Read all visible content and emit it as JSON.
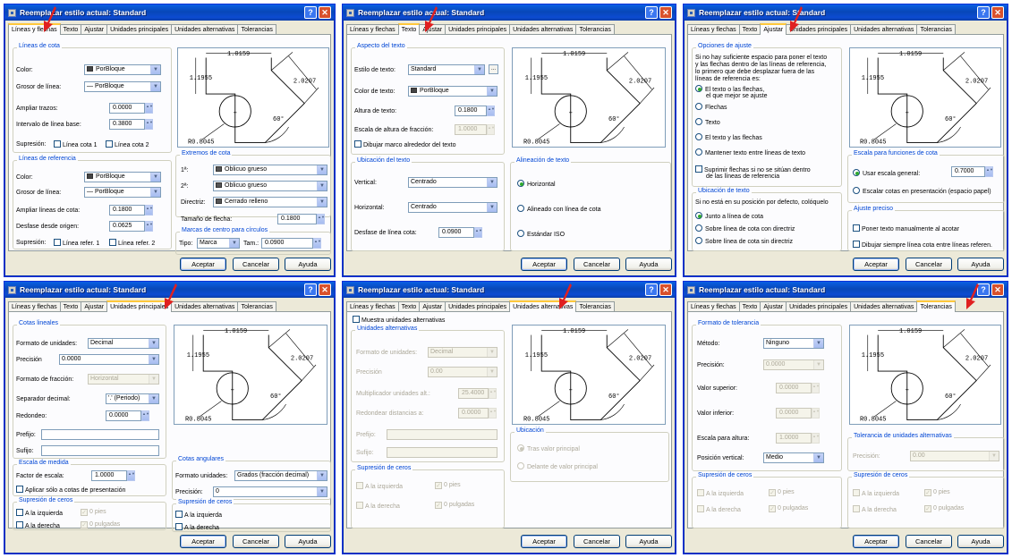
{
  "dialog_title": "Reemplazar estilo actual: Standard",
  "title_buttons": {
    "help": "?",
    "close": "✕"
  },
  "tabs": [
    "Líneas y flechas",
    "Texto",
    "Ajustar",
    "Unidades principales",
    "Unidades alternativas",
    "Tolerancias"
  ],
  "buttons": {
    "ok": "Aceptar",
    "cancel": "Cancelar",
    "help": "Ayuda"
  },
  "preview": {
    "top_dim": "1.0159",
    "left_dim": "1.1955",
    "right_dim": "2.0207",
    "radius": "R0.8045",
    "angle": "60°",
    "center": "+"
  },
  "combo_arrow": "▼",
  "spin_arrows": "▲▼",
  "ellipsis": "...",
  "accent_colors": {
    "titlebar": "#0a5fe4",
    "group_label": "#0046d5",
    "arrow_marker": "#e02020"
  },
  "d1": {
    "g_cota": "Líneas de cota",
    "color_lbl": "Color:",
    "color_val": "PorBloque",
    "grosor_lbl": "Grosor de línea:",
    "grosor_val": "— PorBloque",
    "ampliar_lbl": "Ampliar trazos:",
    "ampliar_val": "0.0000",
    "intervalo_lbl": "Intervalo de línea base:",
    "intervalo_val": "0.3800",
    "supresion_lbl": "Supresión:",
    "sup1": "Línea cota 1",
    "sup2": "Línea cota 2",
    "g_ref": "Líneas de referencia",
    "rcolor_lbl": "Color:",
    "rcolor_val": "PorBloque",
    "rgrosor_lbl": "Grosor de línea:",
    "rgrosor_val": "— PorBloque",
    "rampliar_lbl": "Ampliar líneas de cota:",
    "rampliar_val": "0.1800",
    "desfase_lbl": "Desfase desde origen:",
    "desfase_val": "0.0625",
    "rsupresion_lbl": "Supresión:",
    "rsup1": "Línea refer. 1",
    "rsup2": "Línea refer. 2",
    "g_ext": "Extremos de cota",
    "e1_lbl": "1ª:",
    "e1_val": "Oblicuo grueso",
    "e2_lbl": "2ª:",
    "e2_val": "Oblicuo grueso",
    "dir_lbl": "Directriz:",
    "dir_val": "Cerrado relleno",
    "tam_lbl": "Tamaño de flecha:",
    "tam_val": "0.1800",
    "g_centro": "Marcas de centro para círculos",
    "tipo_lbl": "Tipo:",
    "tipo_val": "Marca",
    "tamc_lbl": "Tam.:",
    "tamc_val": "0.0900"
  },
  "d2": {
    "g_aspecto": "Aspecto del texto",
    "estilo_lbl": "Estilo de texto:",
    "estilo_val": "Standard",
    "color_lbl": "Color de texto:",
    "color_val": "PorBloque",
    "altura_lbl": "Altura de texto:",
    "altura_val": "0.1800",
    "escala_lbl": "Escala de altura de fracción:",
    "escala_val": "1.0000",
    "marco": "Dibujar marco alrededor del texto",
    "g_ubic": "Ubicación del texto",
    "vert_lbl": "Vertical:",
    "vert_val": "Centrado",
    "horiz_lbl": "Horizontal:",
    "horiz_val": "Centrado",
    "desf_lbl": "Desfase de línea cota:",
    "desf_val": "0.0900",
    "g_alin": "Alineación de texto",
    "r1": "Horizontal",
    "r2": "Alineado con línea de cota",
    "r3": "Estándar ISO"
  },
  "d3": {
    "g_opc": "Opciones de ajuste",
    "intro": [
      "Si no hay suficiente espacio para poner el texto",
      "y las flechas dentro de las líneas de referencia,",
      "lo primero que debe desplazar fuera de las",
      "líneas de referencia es:"
    ],
    "r1a": "El texto o las flechas,",
    "r1b": "el que mejor se ajuste",
    "r2": "Flechas",
    "r3": "Texto",
    "r4": "El texto y las flechas",
    "r5": "Mantener texto entre líneas de texto",
    "sup_a": "Suprimir flechas si no se sitúan dentro",
    "sup_b": "de las líneas de referencia",
    "g_ubic": "Ubicación de texto",
    "ubic_intro": "Si no está en su posición por defecto, colóquelo",
    "u1": "Junto a línea de cota",
    "u2": "Sobre línea de cota con directriz",
    "u3": "Sobre línea de cota sin directriz",
    "g_escala": "Escala para funciones de cota",
    "e1": "Usar escala general:",
    "e1_val": "0.7000",
    "e2": "Escalar cotas en presentación (espacio papel)",
    "g_ajuste": "Ajuste preciso",
    "a1": "Poner texto manualmente al acotar",
    "a2": "Dibujar siempre línea cota entre líneas referen."
  },
  "d4": {
    "g_cotas": "Cotas lineales",
    "formato_lbl": "Formato de unidades:",
    "formato_val": "Decimal",
    "prec_lbl": "Precisión",
    "prec_val": "0.0000",
    "frac_lbl": "Formato de fracción:",
    "frac_val": "Horizontal",
    "sep_lbl": "Separador decimal:",
    "sep_val": "'.' (Periodo)",
    "red_lbl": "Redondeo:",
    "red_val": "0.0000",
    "pref_lbl": "Prefijo:",
    "suf_lbl": "Sufijo:",
    "g_medida": "Escala de medida",
    "factor_lbl": "Factor de escala:",
    "factor_val": "1.0000",
    "aplicar": "Aplicar sólo a cotas de presentación",
    "g_sup": "Supresión de ceros",
    "s1": "A la izquierda",
    "s2": "0 pies",
    "s3": "A la derecha",
    "s4": "0 pulgadas",
    "g_ang": "Cotas angulares",
    "af_lbl": "Formato unidades:",
    "af_val": "Grados (fracción decimal)",
    "ap_lbl": "Precisión:",
    "ap_val": "0",
    "g_sup2": "Supresión de ceros",
    "t1": "A la izquierda",
    "t2": "A la derecha"
  },
  "d5": {
    "muestra": "Muestra unidades alternativas",
    "g_alt": "Unidades alternativas",
    "formato_lbl": "Formato de unidades:",
    "formato_val": "Decimal",
    "prec_lbl": "Precisión",
    "prec_val": "0.00",
    "mult_lbl": "Multiplicador unidades alt.:",
    "mult_val": "25.4000",
    "red_lbl": "Redondear distancias a:",
    "red_val": "0.0000",
    "pref_lbl": "Prefijo:",
    "suf_lbl": "Sufijo:",
    "g_sup": "Supresión de ceros",
    "s1": "A la izquierda",
    "s2": "0 pies",
    "s3": "A la derecha",
    "s4": "0 pulgadas",
    "g_ubic": "Ubicación",
    "u1": "Tras valor principal",
    "u2": "Delante de valor principal"
  },
  "d6": {
    "g_formato": "Formato de tolerancia",
    "met_lbl": "Método:",
    "met_val": "Ninguno",
    "prec_lbl": "Precisión:",
    "prec_val": "0.0000",
    "sup_lbl": "Valor superior:",
    "sup_val": "0.0000",
    "inf_lbl": "Valor inferior:",
    "inf_val": "0.0000",
    "esc_lbl": "Escala para altura:",
    "esc_val": "1.0000",
    "pos_lbl": "Posición vertical:",
    "pos_val": "Medio",
    "g_sup": "Supresión de ceros",
    "s1": "A la izquierda",
    "s2": "0 pies",
    "s3": "A la derecha",
    "s4": "0 pulgadas",
    "g_tolalt": "Tolerancia de unidades alternativas",
    "tp_lbl": "Precisión:",
    "tp_val": "0.00",
    "g_sup2": "Supresión de ceros",
    "t1": "A la izquierda",
    "t2": "0 pies",
    "t3": "A la derecha",
    "t4": "0 pulgadas"
  }
}
